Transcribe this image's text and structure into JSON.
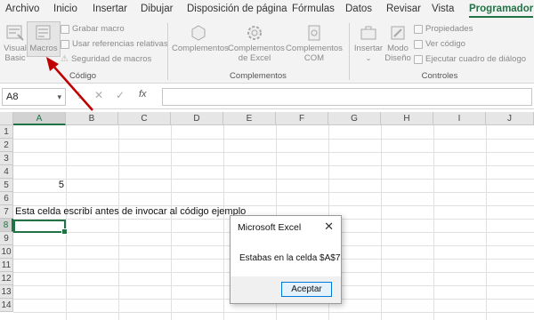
{
  "menu_tabs": [
    "Archivo",
    "Inicio",
    "Insertar",
    "Dibujar",
    "Disposición de página",
    "Fórmulas",
    "Datos",
    "Revisar",
    "Vista",
    "Programador"
  ],
  "active_tab": "Programador",
  "ribbon": {
    "codigo": {
      "visual_basic": "Visual Basic",
      "macros": "Macros",
      "grabar_macro": "Grabar macro",
      "usar_referencias": "Usar referencias relativas",
      "seguridad": "Seguridad de macros",
      "label": "Código"
    },
    "complementos": {
      "complementos": "Complementos",
      "complementos_excel": "Complementos de Excel",
      "complementos_com": "Complementos COM",
      "label": "Complementos"
    },
    "controles": {
      "insertar": "Insertar",
      "modo_diseno": "Modo Diseño",
      "propiedades": "Propiedades",
      "ver_codigo": "Ver código",
      "ejecutar_dialogo": "Ejecutar cuadro de diálogo",
      "label": "Controles"
    }
  },
  "formula_bar": {
    "name_box": "A8",
    "formula": "",
    "fx": "fx"
  },
  "sheet": {
    "columns": [
      "A",
      "B",
      "C",
      "D",
      "E",
      "F",
      "G",
      "H",
      "I",
      "J"
    ],
    "rows": [
      "1",
      "2",
      "3",
      "4",
      "5",
      "6",
      "7",
      "8",
      "9",
      "10",
      "11",
      "12",
      "13",
      "14"
    ],
    "selected_cell": "A8",
    "cells": {
      "A5": "5",
      "A7": "Esta celda escribí antes de invocar al código ejemplo"
    }
  },
  "dialog": {
    "title": "Microsoft Excel",
    "message": "Estabas en la celda $A$7",
    "ok_button": "Aceptar"
  },
  "colors": {
    "accent": "#217346",
    "arrow": "#c00000"
  }
}
